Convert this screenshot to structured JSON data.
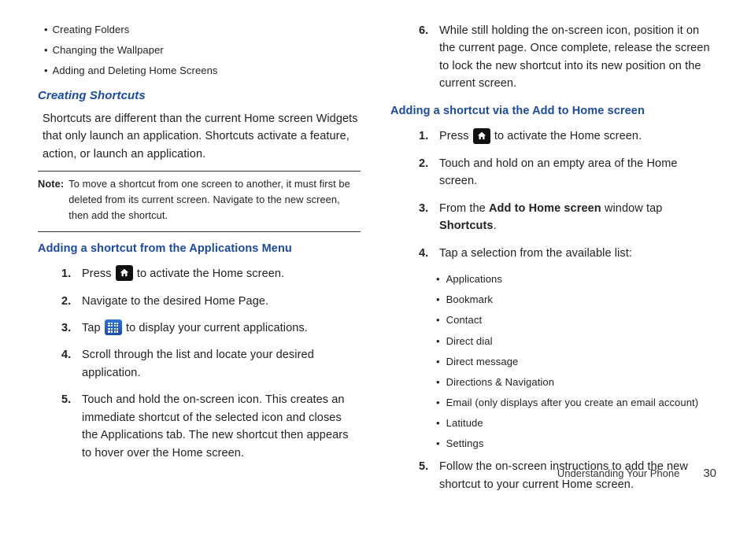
{
  "left": {
    "bullets": [
      "Creating Folders",
      "Changing the Wallpaper",
      "Adding and Deleting Home Screens"
    ],
    "h1": "Creating Shortcuts",
    "para": "Shortcuts are different than the current Home screen Widgets that only launch an application. Shortcuts activate a feature, action, or launch an application.",
    "note_label": "Note:",
    "note_text": "To move a shortcut from one screen to another, it must first be deleted from its current screen. Navigate to the new screen, then add the shortcut.",
    "h2": "Adding a shortcut from the Applications Menu",
    "step1a": "Press ",
    "step1b": " to activate the Home screen.",
    "step2": "Navigate to the desired Home Page.",
    "step3a": "Tap ",
    "step3b": " to display your current applications.",
    "step4": "Scroll through the list and locate your desired application.",
    "step5": "Touch and hold the on-screen icon. This creates an immediate shortcut of the selected icon and closes the Applications tab. The new shortcut then appears to hover over the Home screen."
  },
  "right": {
    "step6": "While still holding the on-screen icon, position it on the current page. Once complete, release the screen to lock the new shortcut into its new position on the current screen.",
    "h3": "Adding a shortcut via the Add to Home screen",
    "r1a": "Press ",
    "r1b": " to activate the Home screen.",
    "r2": "Touch and hold on an empty area of the Home screen.",
    "r3a": "From the ",
    "r3b": "Add to Home screen",
    "r3c": " window tap ",
    "r3d": "Shortcuts",
    "r3e": ".",
    "r4": "Tap a selection from the available list:",
    "sublist": [
      "Applications",
      "Bookmark",
      "Contact",
      "Direct dial",
      "Direct message",
      "Directions & Navigation",
      "Email (only displays after you create an email account)",
      "Latitude",
      "Settings"
    ],
    "r5": "Follow the on-screen instructions to add the new shortcut to your current Home screen."
  },
  "footer": {
    "section": "Understanding Your Phone",
    "page": "30"
  }
}
